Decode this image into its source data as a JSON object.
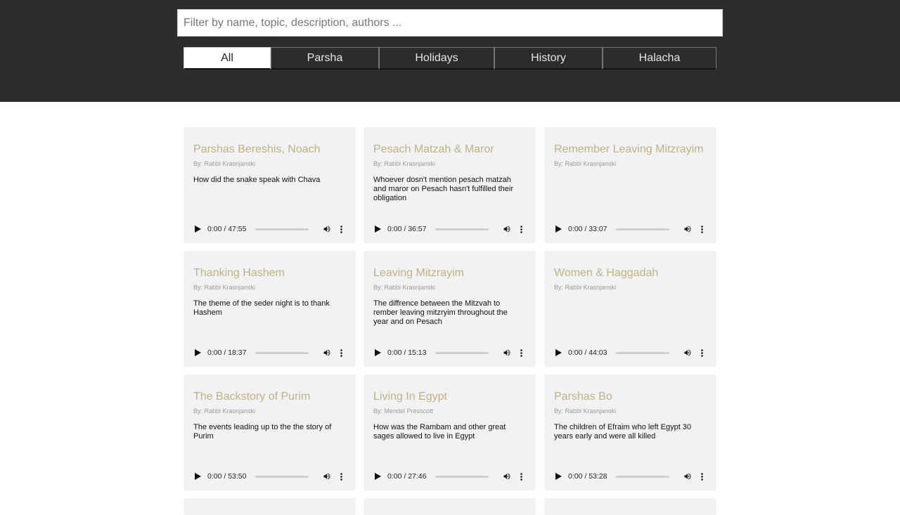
{
  "search": {
    "placeholder": "Filter by name, topic, description, authors ..."
  },
  "tabs": [
    {
      "label": "All",
      "active": true
    },
    {
      "label": "Parsha",
      "active": false
    },
    {
      "label": "Holidays",
      "active": false
    },
    {
      "label": "History",
      "active": false
    },
    {
      "label": "Halacha",
      "active": false
    }
  ],
  "cards": [
    {
      "title": "Parshas Bereshis, Noach",
      "author": "By: Rabbi Krasnjanski",
      "description": "How did the snake speak with Chava",
      "time": "0:00 / 47:55"
    },
    {
      "title": "Pesach Matzah & Maror",
      "author": "By: Rabbi Krasnjanski",
      "description": "Whoever dosn't mention pesach matzah and maror on Pesach hasn't fulfilled their obligation",
      "time": "0:00 / 36:57"
    },
    {
      "title": "Remember Leaving Mitzrayim",
      "author": "By: Rabbi Krasnjanski",
      "description": "",
      "time": "0:00 / 33:07"
    },
    {
      "title": "Thanking Hashem",
      "author": "By: Rabbi Krasnjanski",
      "description": "The theme of the seder night is to thank Hashem",
      "time": "0:00 / 18:37"
    },
    {
      "title": "Leaving Mitzrayim",
      "author": "By: Rabbi Krasnjanski",
      "description": "The diffrence between the Mitzvah to rember leaving mitzryim throughout the year and on Pesach",
      "time": "0:00 / 15:13"
    },
    {
      "title": "Women & Haggadah",
      "author": "By: Rabbi Krasnjanski",
      "description": "",
      "time": "0:00 / 44:03"
    },
    {
      "title": "The Backstory of Purim",
      "author": "By: Rabbi Krasnjanski",
      "description": "The events leading up to the the story of Purim",
      "time": "0:00 / 53:50"
    },
    {
      "title": "Living In Egypt",
      "author": "By: Mendel Presscott",
      "description": "How was the Rambam and other great sages allowed to live in Egypt",
      "time": "0:00 / 27:46"
    },
    {
      "title": "Parshas Bo",
      "author": "By: Rabbi Krasnjanski",
      "description": "The children of Efraim who left Egypt 30 years early and were all killed",
      "time": "0:00 / 53:28"
    }
  ],
  "icons": {
    "play": "play-icon",
    "volume": "volume-icon",
    "more": "more-vert-icon"
  },
  "colors": {
    "header": "#2d2c2c",
    "card_bg": "#f1f2f4",
    "title": "#c3b07e",
    "author": "#9a9a9a"
  }
}
